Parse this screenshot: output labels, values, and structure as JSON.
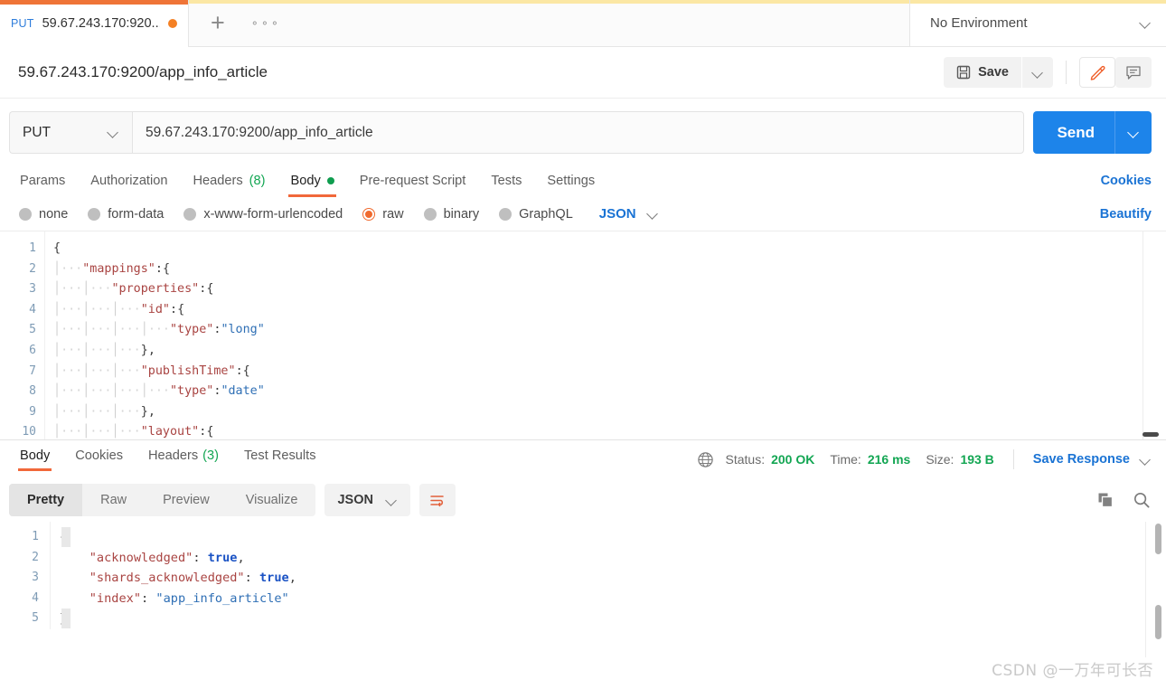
{
  "tabbar": {
    "request_tab": {
      "method": "PUT",
      "name": "59.67.243.170:920...",
      "unsaved_indicator": "unsaved-dot"
    },
    "new_tab_label": "+",
    "more_label": "000",
    "environment": {
      "selected": "No Environment"
    }
  },
  "titlebar": {
    "request_title": "59.67.243.170:9200/app_info_article",
    "save_label": "Save",
    "save_icon": "floppy-disk-icon",
    "save_caret_icon": "chevron-down-icon",
    "edit_icon": "pencil-icon",
    "comment_icon": "comment-icon"
  },
  "urlbar": {
    "method": "PUT",
    "method_caret_icon": "chevron-down-icon",
    "url": "59.67.243.170:9200/app_info_article",
    "send_label": "Send",
    "send_caret_icon": "chevron-down-icon",
    "send_color": "#1d84ea"
  },
  "request_tabs": {
    "items": [
      {
        "label": "Params",
        "active": false
      },
      {
        "label": "Authorization",
        "active": false
      },
      {
        "label": "Headers",
        "count": "(8)",
        "active": false
      },
      {
        "label": "Body",
        "active": true,
        "dot": true
      },
      {
        "label": "Pre-request Script",
        "active": false
      },
      {
        "label": "Tests",
        "active": false
      },
      {
        "label": "Settings",
        "active": false
      }
    ],
    "cookies_link": "Cookies"
  },
  "body_type": {
    "options": [
      {
        "label": "none",
        "selected": false
      },
      {
        "label": "form-data",
        "selected": false
      },
      {
        "label": "x-www-form-urlencoded",
        "selected": false
      },
      {
        "label": "raw",
        "selected": true
      },
      {
        "label": "binary",
        "selected": false
      },
      {
        "label": "GraphQL",
        "selected": false
      }
    ],
    "format": "JSON",
    "format_caret_icon": "chevron-down-icon",
    "beautify_link": "Beautify"
  },
  "request_body": {
    "line_numbers": [
      "1",
      "2",
      "3",
      "4",
      "5",
      "6",
      "7",
      "8",
      "9",
      "10"
    ],
    "lines": [
      "{",
      "    \"mappings\":{",
      "        \"properties\":{",
      "            \"id\":{",
      "                \"type\":\"long\"",
      "            },",
      "            \"publishTime\":{",
      "                \"type\":\"date\"",
      "            },",
      "            \"layout\":{"
    ]
  },
  "response_tabs": {
    "items": [
      {
        "label": "Body",
        "active": true
      },
      {
        "label": "Cookies",
        "active": false
      },
      {
        "label": "Headers",
        "count": "(3)",
        "active": false
      },
      {
        "label": "Test Results",
        "active": false
      }
    ]
  },
  "response_meta": {
    "globe_icon": "globe-icon",
    "status_label": "Status:",
    "status_value": "200 OK",
    "time_label": "Time:",
    "time_value": "216 ms",
    "size_label": "Size:",
    "size_value": "193 B",
    "save_response_label": "Save Response",
    "save_response_caret_icon": "chevron-down-icon",
    "green": "#13a653"
  },
  "response_toolbar": {
    "views": [
      {
        "label": "Pretty",
        "active": true
      },
      {
        "label": "Raw",
        "active": false
      },
      {
        "label": "Preview",
        "active": false
      },
      {
        "label": "Visualize",
        "active": false
      }
    ],
    "format": "JSON",
    "format_caret_icon": "chevron-down-icon",
    "wrap_icon": "word-wrap-icon",
    "copy_icon": "copy-icon",
    "search_icon": "search-icon"
  },
  "response_body": {
    "line_numbers": [
      "1",
      "2",
      "3",
      "4",
      "5"
    ],
    "lines": [
      {
        "indent": "",
        "parts": [
          {
            "t": "{",
            "c": "p"
          }
        ]
      },
      {
        "indent": "    ",
        "parts": [
          {
            "t": "\"acknowledged\"",
            "c": "k"
          },
          {
            "t": ": ",
            "c": "p"
          },
          {
            "t": "true",
            "c": "b"
          },
          {
            "t": ",",
            "c": "p"
          }
        ]
      },
      {
        "indent": "    ",
        "parts": [
          {
            "t": "\"shards_acknowledged\"",
            "c": "k"
          },
          {
            "t": ": ",
            "c": "p"
          },
          {
            "t": "true",
            "c": "b"
          },
          {
            "t": ",",
            "c": "p"
          }
        ]
      },
      {
        "indent": "    ",
        "parts": [
          {
            "t": "\"index\"",
            "c": "k"
          },
          {
            "t": ": ",
            "c": "p"
          },
          {
            "t": "\"app_info_article\"",
            "c": "s"
          }
        ]
      },
      {
        "indent": "",
        "parts": [
          {
            "t": "}",
            "c": "p"
          }
        ]
      }
    ]
  },
  "watermark": {
    "text": "CSDN @一万年可长否"
  }
}
